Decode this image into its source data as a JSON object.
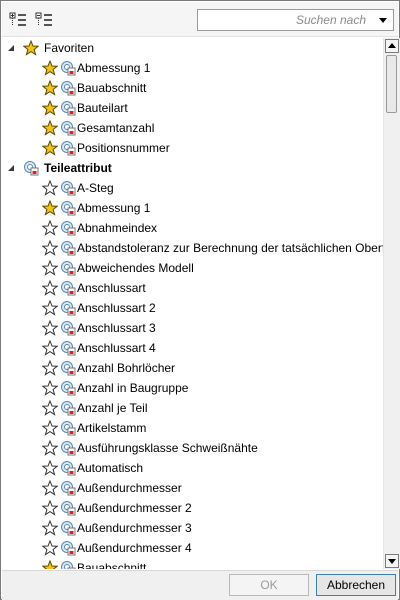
{
  "search": {
    "placeholder": "Suchen nach"
  },
  "footer": {
    "ok_label": "OK",
    "cancel_label": "Abbrechen"
  },
  "tree": [
    {
      "type": "group",
      "label": "Favoriten",
      "icon": "star-filled-icon",
      "bold": false
    },
    {
      "type": "item",
      "label": "Abmessung 1",
      "star": "filled"
    },
    {
      "type": "item",
      "label": "Bauabschnitt",
      "star": "filled"
    },
    {
      "type": "item",
      "label": "Bauteilart",
      "star": "filled"
    },
    {
      "type": "item",
      "label": "Gesamtanzahl",
      "star": "filled"
    },
    {
      "type": "item",
      "label": "Positionsnummer",
      "star": "filled"
    },
    {
      "type": "group",
      "label": "Teileattribut",
      "icon": "attribute-group-icon",
      "bold": true
    },
    {
      "type": "item",
      "label": "A-Steg",
      "star": "empty"
    },
    {
      "type": "item",
      "label": "Abmessung 1",
      "star": "filled"
    },
    {
      "type": "item",
      "label": "Abnahmeindex",
      "star": "empty"
    },
    {
      "type": "item",
      "label": "Abstandstoleranz zur Berechnung der tatsächlichen Oberfl",
      "star": "empty"
    },
    {
      "type": "item",
      "label": "Abweichendes Modell",
      "star": "empty"
    },
    {
      "type": "item",
      "label": "Anschlussart",
      "star": "empty"
    },
    {
      "type": "item",
      "label": "Anschlussart 2",
      "star": "empty"
    },
    {
      "type": "item",
      "label": "Anschlussart 3",
      "star": "empty"
    },
    {
      "type": "item",
      "label": "Anschlussart 4",
      "star": "empty"
    },
    {
      "type": "item",
      "label": "Anzahl Bohrlöcher",
      "star": "empty"
    },
    {
      "type": "item",
      "label": "Anzahl in Baugruppe",
      "star": "empty"
    },
    {
      "type": "item",
      "label": "Anzahl je Teil",
      "star": "empty"
    },
    {
      "type": "item",
      "label": "Artikelstamm",
      "star": "empty"
    },
    {
      "type": "item",
      "label": "Ausführungsklasse Schweißnähte",
      "star": "empty"
    },
    {
      "type": "item",
      "label": "Automatisch",
      "star": "empty"
    },
    {
      "type": "item",
      "label": "Außendurchmesser",
      "star": "empty"
    },
    {
      "type": "item",
      "label": "Außendurchmesser 2",
      "star": "empty"
    },
    {
      "type": "item",
      "label": "Außendurchmesser 3",
      "star": "empty"
    },
    {
      "type": "item",
      "label": "Außendurchmesser 4",
      "star": "empty"
    },
    {
      "type": "item",
      "label": "Bauabschnitt",
      "star": "filled"
    }
  ],
  "colors": {
    "star_fill": "#f6c21a",
    "star_stroke": "#5a4a00",
    "accent_border": "#3c7fb1"
  }
}
